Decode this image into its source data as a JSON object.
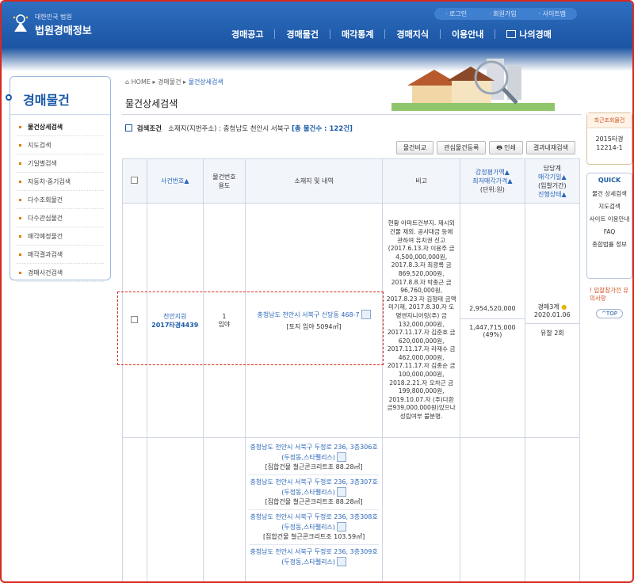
{
  "header": {
    "logo_sub": "대한민국 법원",
    "logo_main": "법원경매정보",
    "util_links": [
      "로그인",
      "회원가입",
      "사이트맵"
    ],
    "gnb": [
      "경매공고",
      "경매물건",
      "매각통계",
      "경매지식",
      "이용안내"
    ],
    "my": "나의경매"
  },
  "sidebar": {
    "title": "경매물건",
    "items": [
      {
        "label": "물건상세검색"
      },
      {
        "label": "지도검색"
      },
      {
        "label": "기일별검색"
      },
      {
        "label": "자동차·중기검색"
      },
      {
        "label": "다수조회물건"
      },
      {
        "label": "다수관심물건"
      },
      {
        "label": "매각예정물건"
      },
      {
        "label": "매각결과검색"
      },
      {
        "label": "경매사건검색"
      }
    ]
  },
  "breadcrumb": {
    "home": "HOME",
    "mid": "경매물건",
    "cur": "물건상세검색"
  },
  "page_title": "물건상세검색",
  "search_condition": {
    "label": "검색조건",
    "text": "소재지(지번주소) : 충청남도 천안시 서북구",
    "count": "[총 물건수 : 122건]"
  },
  "buttons": [
    "물건비교",
    "관심물건등록",
    "인쇄",
    "결과내재검색"
  ],
  "table": {
    "headers": {
      "case": "사건번호▲",
      "item_no": "물건번호",
      "usage": "용도",
      "location": "소재지 및 내역",
      "remark": "비고",
      "appraisal": "감정평가액▲",
      "min_price": "최저매각가격▲",
      "unit": "(단위:원)",
      "dept": "담당계",
      "sale_date": "매각기일▲",
      "bid_period": "(입찰기간)",
      "status": "진행상태▲"
    },
    "row1": {
      "court": "천안지원",
      "case_no": "2017타경4439",
      "item_no": "1",
      "usage": "임야",
      "address": "충청남도 천안시 서북구 신당동 468-7",
      "detail": "[토지 임야 5094㎡]",
      "remark": "현황 아파트건부지. 제시외건물 제외. 공사대금 등에 관하여 유치권 신고(2017.6.13.자 이용주 금4,500,000,000원, 2017.8.3.자 최광록 금869,520,000원, 2017.8.8.자 박종근 금96,760,000원, 2017.8.23 자 김형태 금액 미기재, 2017.8.30.자 도명엔지니어링(주) 금132,000,000원, 2017.11.17.자 김준호 금620,000,000원, 2017.11.17.자 라재수 금462,000,000원, 2017.11.17.자 김종순 금100,000,000원, 2018.2.21.자 오차근 금199,800,000원, 2019.10.07.자 (주)다흰 금939,000,000원)있으나 성립여부 불분명.",
      "appraisal": "2,954,520,000",
      "min_price": "1,447,715,000",
      "min_pct": "(49%)",
      "dept": "경매3계",
      "date": "2020.01.06",
      "status": "유찰 2회"
    },
    "row2_items": [
      {
        "address": "충청남도 천안시 서북구 두정로 236, 3층306호 (두정동,스타펠리스)",
        "detail": "[집합건물 철근콘크리트조 88.28㎡]"
      },
      {
        "address": "충청남도 천안시 서북구 두정로 236, 3층307호 (두정동,스타펠리스)",
        "detail": "[집합건물 철근콘크리트조 88.28㎡]"
      },
      {
        "address": "충청남도 천안시 서북구 두정로 236, 3층308호 (두정동,스타펠리스)",
        "detail": "[집합건물 철근콘크리트조 103.59㎡]"
      },
      {
        "address": "충청남도 천안시 서북구 두정로 236, 3층309호 (두정동,스타펠리스)",
        "detail": ""
      }
    ]
  },
  "rightbar": {
    "recent_title": "최근조회물건",
    "recent_value": "2015타경 12214-1",
    "quick": "QUICK",
    "quick_items": [
      "물건 상세검색",
      "지도검색",
      "사이트 이용안내",
      "FAQ",
      "종합법률 정보"
    ],
    "notice": "입찰참가전 유의사항",
    "top": "TOP"
  }
}
